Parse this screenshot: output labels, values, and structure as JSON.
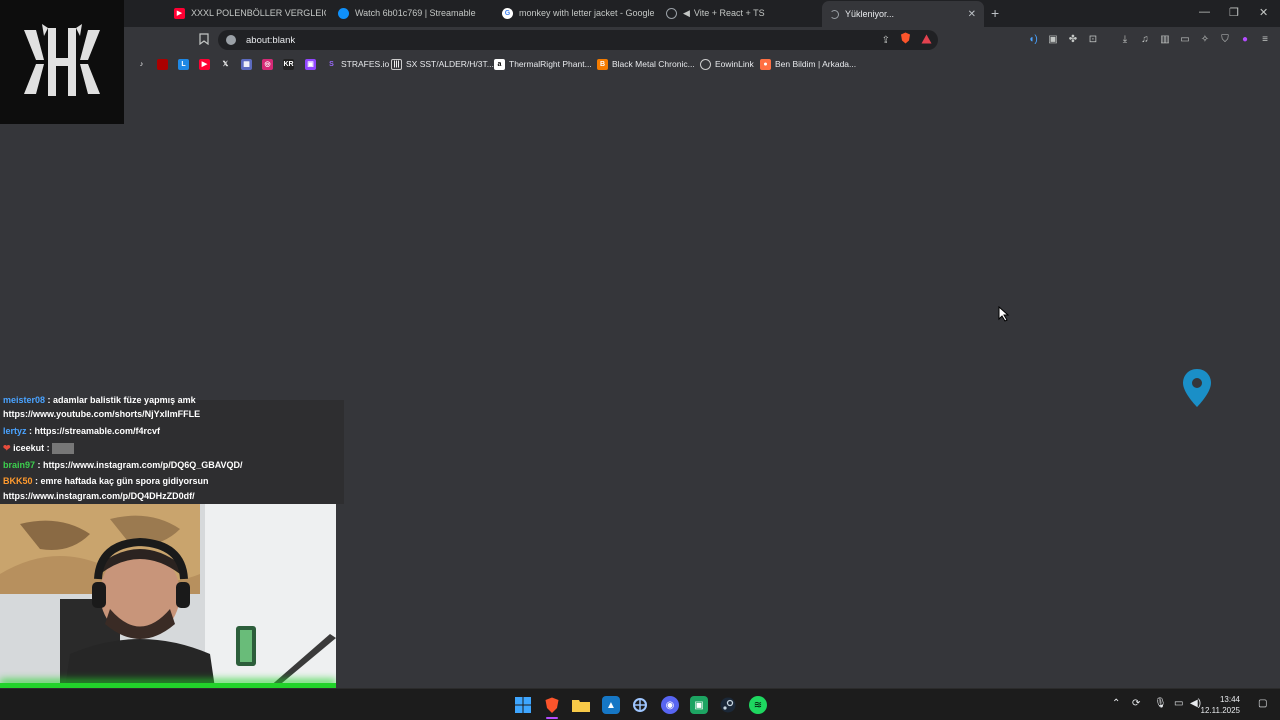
{
  "tabs": [
    {
      "label": "XXXL POLENBÖLLER VERGLEICH BIG",
      "icon": "youtube-icon",
      "color": "#ff0033"
    },
    {
      "label": "Watch 6b01c769 | Streamable",
      "icon": "streamable-icon",
      "color": "#0f90fa"
    },
    {
      "label": "monkey with letter jacket - Google'd",
      "icon": "google-icon",
      "color": "#ffffff"
    },
    {
      "label": "Vite + React + TS",
      "icon": "globe-icon",
      "color": "#9aa0a6"
    },
    {
      "label": "Yükleniyor...",
      "icon": "loading-icon",
      "color": "#9aa0a6"
    }
  ],
  "address_bar": {
    "url": "about:blank"
  },
  "bookmarks": [
    {
      "label": "STRAFES.io",
      "color": "#7b42ff"
    },
    {
      "label": "SX SST/ALDER/H/3T...",
      "color": "#cccccc"
    },
    {
      "label": "ThermalRight Phant...",
      "color": "#dddddd"
    },
    {
      "label": "Black Metal Chronic...",
      "color": "#f57c00"
    },
    {
      "label": "EowinLink",
      "color": "#cccccc"
    },
    {
      "label": "Ben Bildim | Arkada...",
      "color": "#ff7043"
    }
  ],
  "chat": [
    {
      "user": "meister08",
      "text": " : adamlar balistik füze yapmış amk",
      "user_color": "#4aa3ff"
    },
    {
      "user": "",
      "text": "https://www.youtube.com/shorts/NjYxIlmFFLE",
      "user_color": "#ffffff"
    },
    {
      "user": "lertyz",
      "text": " : https://streamable.com/f4rcvf",
      "user_color": "#4aa3ff"
    },
    {
      "user": "iceekut",
      "text": " : ",
      "user_color": "#ffffff"
    },
    {
      "user": "brain97",
      "text": " : https://www.instagram.com/p/DQ6Q_GBAVQD/",
      "user_color": "#3ccf4e"
    },
    {
      "user": "BKK50",
      "text": " : emre haftada kaç gün spora gidiyorsun",
      "user_color": "#ff9a2e"
    },
    {
      "user": "",
      "text": "https://www.instagram.com/p/DQ4DHzZD0df/",
      "user_color": "#ffffff"
    }
  ],
  "clock": {
    "time": "13:44",
    "date": "12.11.2025"
  },
  "colors": {
    "page_bg": "#35363a",
    "tabstrip_bg": "#202124",
    "taskbar_bg": "#1c1c1c",
    "accent_green": "#22d32a"
  }
}
